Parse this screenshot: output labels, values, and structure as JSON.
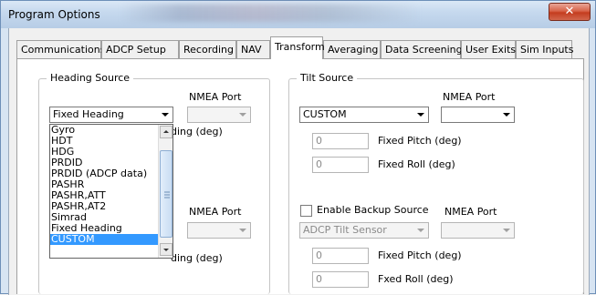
{
  "window": {
    "title": "Program Options",
    "close_glyph": "✕"
  },
  "tabs": [
    "Communications",
    "ADCP Setup",
    "Recording",
    "NAV",
    "Transform",
    "Averaging",
    "Data Screening",
    "User Exits",
    "Sim Inputs"
  ],
  "active_tab": "Transform",
  "heading": {
    "group_title": "Heading Source",
    "nmea_port_label": "NMEA Port",
    "selected": "Fixed Heading",
    "fixed_heading_label_partial": "ding (deg)",
    "backup_nmea_port_label": "NMEA Port",
    "backup_fixed_heading_label_partial": "ding (deg)",
    "dropdown_options": [
      "Gyro",
      "HDT",
      "HDG",
      "PRDID",
      "PRDID (ADCP data)",
      "PASHR",
      "PASHR,ATT",
      "PASHR,AT2",
      "Simrad",
      "Fixed Heading",
      "CUSTOM"
    ],
    "highlighted_option": "CUSTOM"
  },
  "tilt": {
    "group_title": "Tilt Source",
    "nmea_port_label": "NMEA Port",
    "selected": "CUSTOM",
    "fixed_pitch_value": "0",
    "fixed_pitch_label": "Fixed Pitch (deg)",
    "fixed_roll_value": "0",
    "fixed_roll_label": "Fixed Roll (deg)",
    "enable_backup_label": "Enable Backup Source",
    "backup_nmea_port_label": "NMEA Port",
    "backup_selected": "ADCP Tilt Sensor",
    "backup_pitch_value": "0",
    "backup_pitch_label": "Fixed Pitch (deg)",
    "backup_roll_value": "0",
    "backup_roll_label": "Fxed Roll (deg)"
  }
}
